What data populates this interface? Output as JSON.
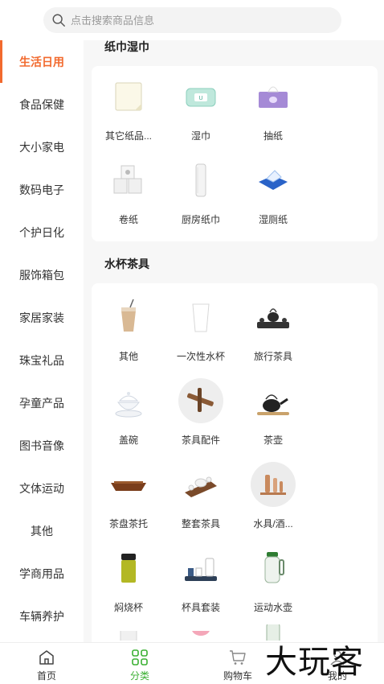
{
  "search": {
    "placeholder": "点击搜索商品信息"
  },
  "sidebar": {
    "items": [
      {
        "label": "生活日用",
        "active": true
      },
      {
        "label": "食品保健"
      },
      {
        "label": "大小家电"
      },
      {
        "label": "数码电子"
      },
      {
        "label": "个护日化"
      },
      {
        "label": "服饰箱包"
      },
      {
        "label": "家居家装"
      },
      {
        "label": "珠宝礼品"
      },
      {
        "label": "孕童产品"
      },
      {
        "label": "图书音像"
      },
      {
        "label": "文体运动"
      },
      {
        "label": "其他"
      },
      {
        "label": "学商用品"
      },
      {
        "label": "车辆养护"
      }
    ]
  },
  "sections": [
    {
      "title": "纸巾湿巾",
      "items": [
        {
          "label": "其它纸品...",
          "icon": "paper-sheet-icon"
        },
        {
          "label": "湿巾",
          "icon": "wet-wipes-icon"
        },
        {
          "label": "抽纸",
          "icon": "tissue-box-icon"
        },
        {
          "label": "卷纸",
          "icon": "toilet-roll-icon"
        },
        {
          "label": "厨房纸巾",
          "icon": "kitchen-roll-icon"
        },
        {
          "label": "湿厕纸",
          "icon": "wet-toilet-paper-icon"
        }
      ]
    },
    {
      "title": "水杯茶具",
      "items": [
        {
          "label": "其他",
          "icon": "milk-tea-cup-icon"
        },
        {
          "label": "一次性水杯",
          "icon": "paper-cup-icon"
        },
        {
          "label": "旅行茶具",
          "icon": "travel-tea-set-icon"
        },
        {
          "label": "盖碗",
          "icon": "lidded-bowl-icon"
        },
        {
          "label": "茶具配件",
          "icon": "tea-tools-icon"
        },
        {
          "label": "茶壶",
          "icon": "teapot-icon"
        },
        {
          "label": "茶盘茶托",
          "icon": "tea-tray-icon"
        },
        {
          "label": "整套茶具",
          "icon": "full-tea-set-icon"
        },
        {
          "label": "水具/酒...",
          "icon": "wine-set-icon"
        },
        {
          "label": "焖烧杯",
          "icon": "thermal-cup-icon"
        },
        {
          "label": "杯具套装",
          "icon": "cup-set-icon"
        },
        {
          "label": "运动水壶",
          "icon": "sport-bottle-icon"
        }
      ]
    }
  ],
  "tabbar": {
    "items": [
      {
        "label": "首页",
        "icon": "home-icon"
      },
      {
        "label": "分类",
        "icon": "category-icon",
        "active": true
      },
      {
        "label": "购物车",
        "icon": "cart-icon"
      },
      {
        "label": "我的",
        "icon": "user-icon"
      }
    ]
  },
  "watermark": {
    "text": "大玩客"
  },
  "colors": {
    "accent": "#f26a2e",
    "tab_active": "#3cb034",
    "page_bg": "#f7f7f7"
  }
}
